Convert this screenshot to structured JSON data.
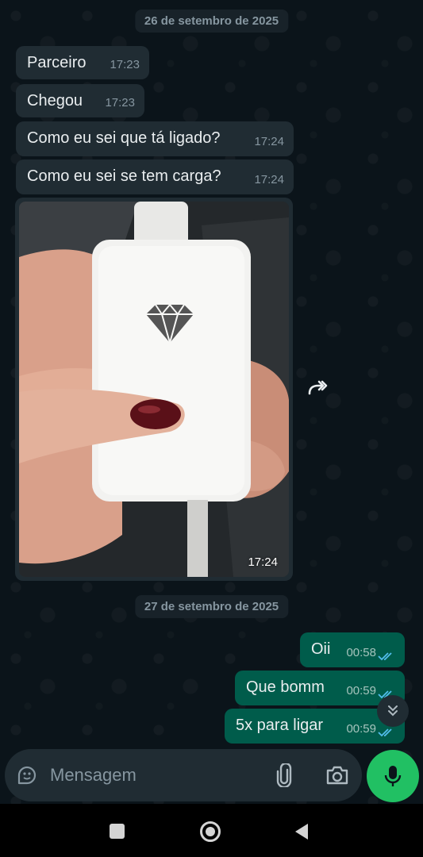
{
  "dates": [
    "26 de setembro de 2025",
    "27 de setembro de 2025"
  ],
  "incoming": [
    {
      "text": "Parceiro",
      "time": "17:23"
    },
    {
      "text": "Chegou",
      "time": "17:23"
    },
    {
      "text": "Como eu sei que tá ligado?",
      "time": "17:24"
    },
    {
      "text": "Como eu sei se tem carga?",
      "time": "17:24"
    }
  ],
  "image_message": {
    "time": "17:24"
  },
  "outgoing": [
    {
      "text": "Oii",
      "time": "00:58",
      "status": "read"
    },
    {
      "text": "Que bomm",
      "time": "00:59",
      "status": "read"
    },
    {
      "text": "5x para ligar",
      "time": "00:59",
      "status": "read"
    }
  ],
  "composer": {
    "placeholder": "Mensagem"
  },
  "icons": {
    "sticker": "sticker-icon",
    "attach": "paperclip-icon",
    "camera": "camera-icon",
    "mic": "microphone-icon",
    "forward": "forward-icon",
    "scroll": "double-chevron-down-icon",
    "nav": [
      "square-icon",
      "circle-icon",
      "back-triangle-icon"
    ]
  },
  "colors": {
    "background": "#0b141a",
    "incoming_bubble": "#202c33",
    "outgoing_bubble": "#005c4b",
    "read_ticks": "#53bdeb",
    "mic_button": "#21c063"
  }
}
